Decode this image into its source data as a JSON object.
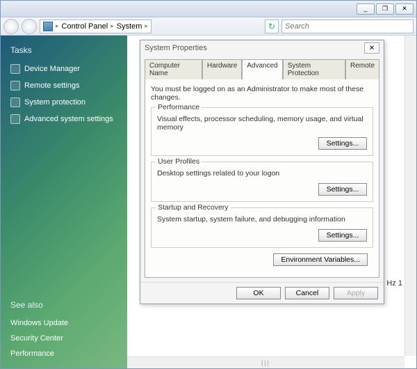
{
  "titlebar": {
    "min": "_",
    "max": "❐",
    "close": "✕"
  },
  "breadcrumb": {
    "item1": "Control Panel",
    "item2": "System"
  },
  "search": {
    "placeholder": "Search"
  },
  "sidebar": {
    "tasks_heading": "Tasks",
    "tasks": [
      {
        "label": "Device Manager"
      },
      {
        "label": "Remote settings"
      },
      {
        "label": "System protection"
      },
      {
        "label": "Advanced system settings"
      }
    ],
    "seealso_heading": "See also",
    "seealso": [
      {
        "label": "Windows Update"
      },
      {
        "label": "Security Center"
      },
      {
        "label": "Performance"
      }
    ]
  },
  "background_text": "Hz  1",
  "dialog": {
    "title": "System Properties",
    "tabs": [
      {
        "label": "Computer Name"
      },
      {
        "label": "Hardware"
      },
      {
        "label": "Advanced"
      },
      {
        "label": "System Protection"
      },
      {
        "label": "Remote"
      }
    ],
    "admin_note": "You must be logged on as an Administrator to make most of these changes.",
    "groups": {
      "perf": {
        "title": "Performance",
        "desc": "Visual effects, processor scheduling, memory usage, and virtual memory",
        "button": "Settings..."
      },
      "profiles": {
        "title": "User Profiles",
        "desc": "Desktop settings related to your logon",
        "button": "Settings..."
      },
      "startup": {
        "title": "Startup and Recovery",
        "desc": "System startup, system failure, and debugging information",
        "button": "Settings..."
      }
    },
    "env_button": "Environment Variables...",
    "buttons": {
      "ok": "OK",
      "cancel": "Cancel",
      "apply": "Apply"
    }
  }
}
